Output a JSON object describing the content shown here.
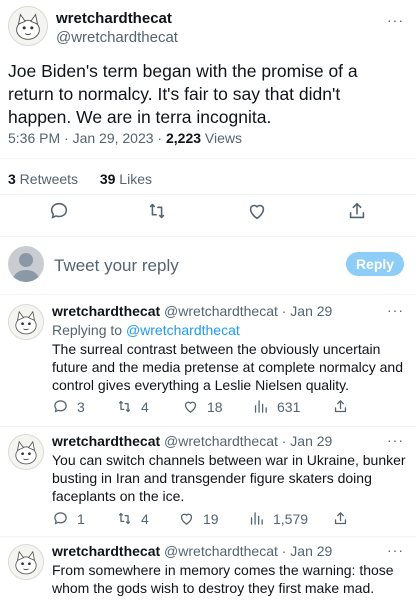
{
  "main_tweet": {
    "display_name": "wretchardthecat",
    "handle": "@wretchardthecat",
    "text": "Joe Biden's term began with the promise of a return to normalcy. It's fair to say that didn't happen. We are in terra incognita.",
    "time": "5:36 PM · Jan 29, 2023 · ",
    "views_count": "2,223",
    "views_label": " Views",
    "retweets_count": "3",
    "retweets_label": " Retweets",
    "likes_count": "39",
    "likes_label": " Likes"
  },
  "compose": {
    "placeholder": "Tweet your reply",
    "button": "Reply"
  },
  "replies": [
    {
      "display_name": "wretchardthecat",
      "handle_date": " @wretchardthecat · Jan 29",
      "replying_prefix": "Replying to ",
      "replying_handle": "@wretchardthecat",
      "text": "The surreal contrast between the obviously uncertain future and the media pretense at complete normalcy and control gives everything a Leslie Nielsen quality.",
      "replies": "3",
      "retweets": "4",
      "likes": "18",
      "views": "631"
    },
    {
      "display_name": "wretchardthecat",
      "handle_date": " @wretchardthecat · Jan 29",
      "text": "You can switch channels between war in Ukraine, bunker busting in Iran and transgender figure skaters doing faceplants on the ice.",
      "replies": "1",
      "retweets": "4",
      "likes": "19",
      "views": "1,579"
    },
    {
      "display_name": "wretchardthecat",
      "handle_date": " @wretchardthecat · Jan 29",
      "text": "From somewhere in memory comes the warning: those whom the gods wish to destroy they first make mad."
    }
  ],
  "more_label": "···",
  "colors": {
    "accent": "#1d9bf0",
    "reply_button": "#8ecdf8",
    "muted": "#536471"
  }
}
